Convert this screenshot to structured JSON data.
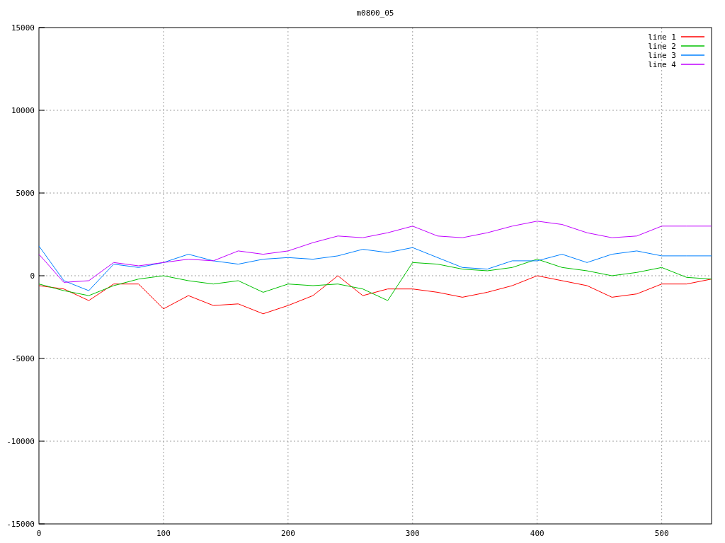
{
  "chart_data": {
    "type": "line",
    "title": "m0800_05",
    "grid": true,
    "legend": true,
    "xlim": [
      0,
      540
    ],
    "ylim": [
      -15000,
      15000
    ],
    "xticks": [
      0,
      100,
      200,
      300,
      400,
      500
    ],
    "yticks": [
      -15000,
      -10000,
      -5000,
      0,
      5000,
      10000,
      15000
    ],
    "x": [
      0,
      20,
      40,
      60,
      80,
      100,
      120,
      140,
      160,
      180,
      200,
      220,
      240,
      260,
      280,
      300,
      320,
      340,
      360,
      380,
      400,
      420,
      440,
      460,
      480,
      500,
      520,
      540
    ],
    "series": [
      {
        "name": "line 1",
        "color": "#ff0000",
        "values": [
          -600,
          -800,
          -1500,
          -500,
          -500,
          -2000,
          -1200,
          -1800,
          -1700,
          -2300,
          -1800,
          -1200,
          0,
          -1200,
          -800,
          -800,
          -1000,
          -1300,
          -1000,
          -600,
          0,
          -300,
          -600,
          -1300,
          -1100,
          -500,
          -500,
          -200
        ]
      },
      {
        "name": "line 2",
        "color": "#00c000",
        "values": [
          -500,
          -900,
          -1200,
          -600,
          -200,
          0,
          -300,
          -500,
          -300,
          -1000,
          -500,
          -600,
          -500,
          -800,
          -1500,
          800,
          700,
          400,
          300,
          500,
          1000,
          500,
          300,
          0,
          200,
          500,
          -100,
          -200
        ]
      },
      {
        "name": "line 3",
        "color": "#0080ff",
        "values": [
          1800,
          -300,
          -900,
          700,
          500,
          800,
          1300,
          900,
          700,
          1000,
          1100,
          1000,
          1200,
          1600,
          1400,
          1700,
          1100,
          500,
          400,
          900,
          900,
          1300,
          800,
          1300,
          1500,
          1200,
          1200,
          1200
        ]
      },
      {
        "name": "line 4",
        "color": "#c000ff",
        "values": [
          1300,
          -400,
          -300,
          800,
          600,
          800,
          1000,
          900,
          1500,
          1300,
          1500,
          2000,
          2400,
          2300,
          2600,
          3000,
          2400,
          2300,
          2600,
          3000,
          3300,
          3100,
          2600,
          2300,
          2400,
          3000,
          3000,
          3000
        ]
      }
    ]
  }
}
